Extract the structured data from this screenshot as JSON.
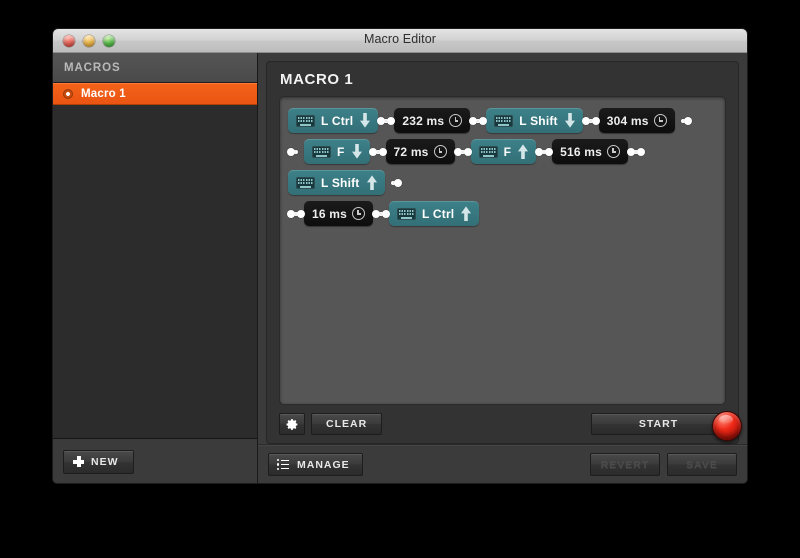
{
  "window": {
    "title": "Macro Editor",
    "traffic_lights": [
      "close-button",
      "minimize-button",
      "zoom-button"
    ]
  },
  "sidebar": {
    "header": "MACROS",
    "items": [
      {
        "label": "Macro 1",
        "icon": "record-dot-icon",
        "selected": true
      }
    ],
    "new_button": {
      "label": "NEW",
      "icon": "plus-icon"
    }
  },
  "main": {
    "title": "MACRO 1",
    "toolbar": {
      "settings_button": {
        "label": "",
        "icon": "gear-icon"
      },
      "clear_button": {
        "label": "CLEAR"
      },
      "start_button": {
        "label": "START"
      },
      "record_button": {
        "icon": "record-button",
        "color": "#ef2a18"
      }
    }
  },
  "footer": {
    "manage_button": {
      "label": "MANAGE",
      "icon": "list-icon"
    },
    "revert_button": {
      "label": "REVERT",
      "disabled": true
    },
    "save_button": {
      "label": "SAVE",
      "disabled": true
    }
  },
  "colors": {
    "key_chip": "#3d8189",
    "delay_chip": "#0d0d0d",
    "selection": "#ea5513",
    "record": "#ef2a18",
    "panel": "#565656"
  },
  "steps": [
    {
      "type": "key",
      "label": "L Ctrl",
      "direction": "down",
      "icon": "keyboard-icon"
    },
    {
      "type": "delay",
      "label": "232 ms",
      "icon": "clock-icon"
    },
    {
      "type": "key",
      "label": "L Shift",
      "direction": "down",
      "icon": "keyboard-icon"
    },
    {
      "type": "delay",
      "label": "304 ms",
      "icon": "clock-icon"
    },
    {
      "type": "key",
      "label": "F",
      "direction": "down",
      "icon": "keyboard-icon"
    },
    {
      "type": "delay",
      "label": "72 ms",
      "icon": "clock-icon"
    },
    {
      "type": "key",
      "label": "F",
      "direction": "up",
      "icon": "keyboard-icon"
    },
    {
      "type": "delay",
      "label": "516 ms",
      "icon": "clock-icon"
    },
    {
      "type": "key",
      "label": "L Shift",
      "direction": "up",
      "icon": "keyboard-icon"
    },
    {
      "type": "delay",
      "label": "16 ms",
      "icon": "clock-icon"
    },
    {
      "type": "key",
      "label": "L Ctrl",
      "direction": "up",
      "icon": "keyboard-icon"
    }
  ]
}
